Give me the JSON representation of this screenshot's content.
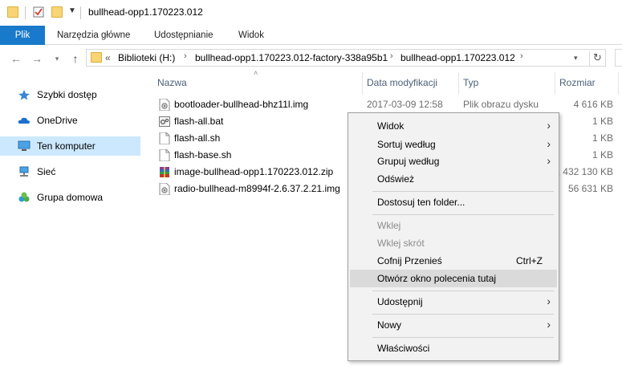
{
  "window": {
    "title": "bullhead-opp1.170223.012"
  },
  "ribbon": {
    "tabs": [
      "Plik",
      "Narzędzia główne",
      "Udostępnianie",
      "Widok"
    ]
  },
  "address": {
    "prefix": "«",
    "crumbs": [
      "Biblioteki (H:)",
      "bullhead-opp1.170223.012-factory-338a95b1",
      "bullhead-opp1.170223.012"
    ]
  },
  "sidebar": {
    "items": [
      {
        "label": "Szybki dostęp",
        "icon": "star-icon"
      },
      {
        "label": "OneDrive",
        "icon": "cloud-icon"
      },
      {
        "label": "Ten komputer",
        "icon": "computer-icon",
        "selected": true
      },
      {
        "label": "Sieć",
        "icon": "network-icon"
      },
      {
        "label": "Grupa domowa",
        "icon": "homegroup-icon"
      }
    ]
  },
  "columns": {
    "name": "Nazwa",
    "date": "Data modyfikacji",
    "type": "Typ",
    "size": "Rozmiar"
  },
  "files": [
    {
      "name": "bootloader-bullhead-bhz11l.img",
      "date": "2017-03-09 12:58",
      "type": "Plik obrazu dysku",
      "size": "4 616 KB",
      "icon": "disk-image-icon"
    },
    {
      "name": "flash-all.bat",
      "date": "",
      "type": "",
      "size": "1 KB",
      "icon": "batch-file-icon"
    },
    {
      "name": "flash-all.sh",
      "date": "",
      "type": "",
      "size": "1 KB",
      "icon": "file-icon"
    },
    {
      "name": "flash-base.sh",
      "date": "",
      "type": "",
      "size": "1 KB",
      "icon": "file-icon"
    },
    {
      "name": "image-bullhead-opp1.170223.012.zip",
      "date": "",
      "type": "",
      "size": "1 432 130 KB",
      "icon": "zip-archive-icon"
    },
    {
      "name": "radio-bullhead-m8994f-2.6.37.2.21.img",
      "date": "",
      "type": "",
      "size": "56 631 KB",
      "icon": "disk-image-icon"
    }
  ],
  "context_menu": {
    "items": {
      "view": "Widok",
      "sort_by": "Sortuj według",
      "group_by": "Grupuj według",
      "refresh": "Odśwież",
      "customize": "Dostosuj ten folder...",
      "paste": "Wklej",
      "paste_shortcut": "Wklej skrót",
      "undo_move": "Cofnij Przenieś",
      "undo_move_shortcut": "Ctrl+Z",
      "open_cmd": "Otwórz okno polecenia tutaj",
      "share": "Udostępnij",
      "new": "Nowy",
      "properties": "Właściwości"
    }
  },
  "colors": {
    "accent": "#1979ca",
    "selection": "#cce8ff",
    "menu_highlight": "#dadada",
    "header_text": "#4c607a"
  }
}
